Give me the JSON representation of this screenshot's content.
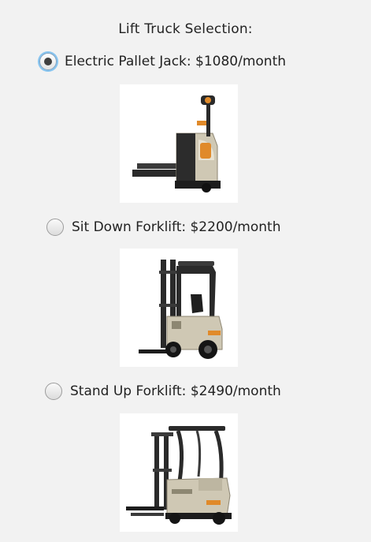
{
  "header": {
    "title": "Lift Truck Selection:"
  },
  "options": [
    {
      "label": "Electric Pallet Jack: $1080/month",
      "selected": true,
      "image_icon": "electric-pallet-jack-photo"
    },
    {
      "label": "Sit Down Forklift: $2200/month",
      "selected": false,
      "image_icon": "sit-down-forklift-photo"
    },
    {
      "label": "Stand Up Forklift: $2490/month",
      "selected": false,
      "image_icon": "stand-up-forklift-photo"
    }
  ],
  "colors": {
    "background": "#f2f2f2",
    "focus_ring": "#87c5f0",
    "truck_body": "#cfc8b4",
    "truck_dark": "#2a2a2a",
    "accent_orange": "#e08a2a"
  }
}
